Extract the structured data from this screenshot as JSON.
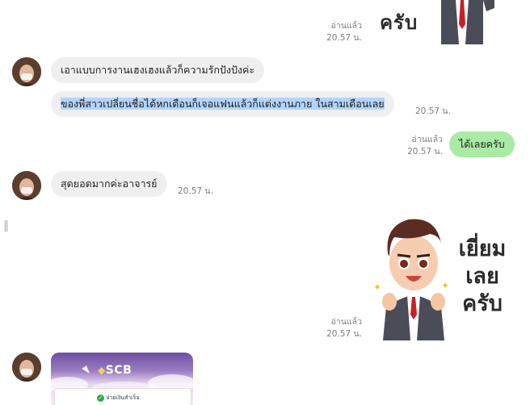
{
  "messages": {
    "read_label": "อ่านแล้ว",
    "m1_time": "20.57 น.",
    "sticker1_text": "ครับ",
    "m2_text": "เอาแบบการงานเฮงเฮงแล้วก็ความรักปังปังค่ะ",
    "m3_text": "ของพี่สาวเปลี่ยนชื่อได้หกเดือนก็เจอแฟนแล้วก็แต่งงานภาย ในสามเดือนเลย",
    "m3_time": "20.57 น.",
    "m4_text": "ได้เลยครับ",
    "m4_time": "20.57 น.",
    "m5_text": "สุดยอดมากค่ะอาจารย์",
    "m5_time": "20.57 น.",
    "sticker2_line1": "เยี่ยม",
    "sticker2_line2": "เลย",
    "sticker2_line3": "ครับ",
    "sticker2_time": "20.57 น.",
    "scb_brand": "SCB",
    "scb_status": "จ่ายเงินสำเร็จ"
  },
  "colors": {
    "my_bubble": "#a9eaa4",
    "their_bubble": "#efefef",
    "selection": "#b3d4fc",
    "scb_purple": "#7b5ea8"
  },
  "icons": {
    "avatar": "user-avatar",
    "sticker": "businessman-thumbs-up-sticker",
    "scb_logo": "scb-logo-icon",
    "check": "check-circle-icon"
  }
}
